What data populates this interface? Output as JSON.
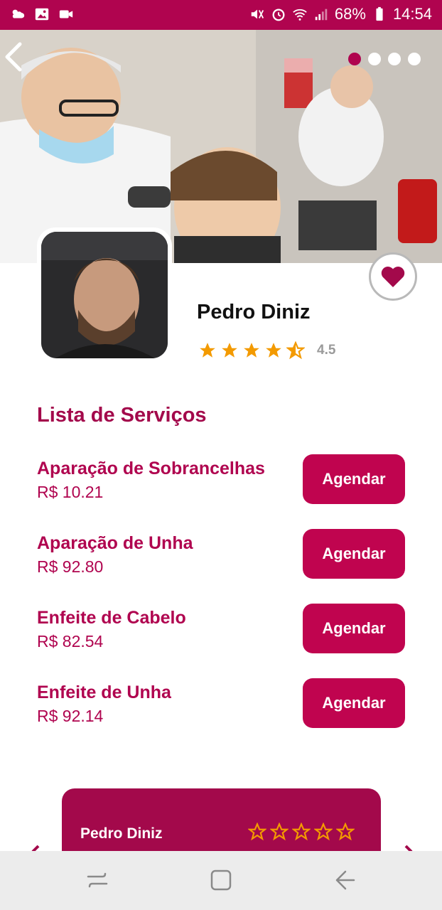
{
  "status_bar": {
    "battery": "68%",
    "time": "14:54",
    "icons": [
      "weather-icon",
      "gallery-icon",
      "video-icon",
      "mute-icon",
      "alarm-icon",
      "wifi-icon",
      "signal-icon",
      "battery-icon"
    ]
  },
  "hero": {
    "carousel_pages": 4,
    "active_page": 1
  },
  "profile": {
    "name": "Pedro Diniz",
    "rating": "4.5",
    "rating_value": 4.5
  },
  "services": {
    "title": "Lista de Serviços",
    "items": [
      {
        "name": "Aparação de Sobrancelhas",
        "price": "R$ 10.21",
        "button": "Agendar"
      },
      {
        "name": "Aparação de Unha",
        "price": "R$ 92.80",
        "button": "Agendar"
      },
      {
        "name": "Enfeite de Cabelo",
        "price": "R$ 82.54",
        "button": "Agendar"
      },
      {
        "name": "Enfeite de Unha",
        "price": "R$ 92.14",
        "button": "Agendar"
      }
    ]
  },
  "review_card": {
    "name": "Pedro Diniz",
    "stars_filled": 0
  },
  "colors": {
    "primary": "#b0044f",
    "star": "#f39a00"
  }
}
